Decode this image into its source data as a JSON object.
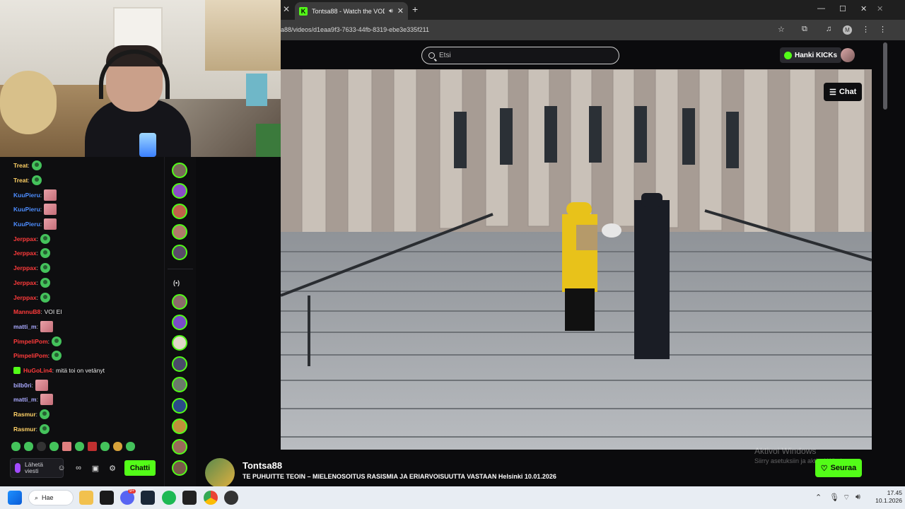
{
  "browser": {
    "tab_title": "Tontsa88 - Watch the VOD",
    "url": "a88/videos/d1eaa9f3-7633-44fb-8319-ebe3e335f211",
    "profile_initial": "M"
  },
  "kick": {
    "search_placeholder": "Etsi",
    "get_kicks_label": "Hanki KICKs",
    "chat_toggle_label": "Chat",
    "channel_name": "Tontsa88",
    "video_title": "TE PUHUITTE TEOIN – MIELENOSOITUS RASISMIA JA ERIARVOISUUTTA VASTAAN Helsinki 10.01.2026",
    "follow_label": "Seuraa"
  },
  "chat": {
    "messages": [
      {
        "user": "Treat",
        "color": "#ffd166",
        "text": "",
        "emote": "green"
      },
      {
        "user": "Treat",
        "color": "#ffd166",
        "text": "",
        "emote": "green"
      },
      {
        "user": "KuuPieru",
        "color": "#4d8dff",
        "text": "",
        "emote": "pink"
      },
      {
        "user": "KuuPieru",
        "color": "#4d8dff",
        "text": "",
        "emote": "pink"
      },
      {
        "user": "KuuPieru",
        "color": "#4d8dff",
        "text": "",
        "emote": "pink"
      },
      {
        "user": "Jerppax",
        "color": "#ff3b3b",
        "text": "",
        "emote": "green"
      },
      {
        "user": "Jerppax",
        "color": "#ff3b3b",
        "text": "",
        "emote": "green"
      },
      {
        "user": "Jerppax",
        "color": "#ff3b3b",
        "text": "",
        "emote": "green"
      },
      {
        "user": "Jerppax",
        "color": "#ff3b3b",
        "text": "",
        "emote": "green"
      },
      {
        "user": "Jerppax",
        "color": "#ff3b3b",
        "text": "",
        "emote": "green"
      },
      {
        "user": "MannuB8",
        "color": "#ff3b3b",
        "text": "VOI EI",
        "emote": ""
      },
      {
        "user": "matti_m",
        "color": "#a9a9ff",
        "text": "",
        "emote": "pink"
      },
      {
        "user": "PimpeliPom",
        "color": "#ff3b3b",
        "text": "",
        "emote": "green"
      },
      {
        "user": "PimpeliPom",
        "color": "#ff3b3b",
        "text": "",
        "emote": "green"
      },
      {
        "user": "HuGoLin4",
        "color": "#ff3b3b",
        "text": "mitä toi on vetänyt",
        "emote": "",
        "badge": true
      },
      {
        "user": "bilb0ri",
        "color": "#a9a9ff",
        "text": "",
        "emote": "pink"
      },
      {
        "user": "matti_m",
        "color": "#a9a9ff",
        "text": "",
        "emote": "pink"
      },
      {
        "user": "Rasmur",
        "color": "#ffd166",
        "text": "",
        "emote": "green"
      },
      {
        "user": "Rasmur",
        "color": "#ffd166",
        "text": "",
        "emote": "green"
      }
    ],
    "input_placeholder": "Lähetä viesti",
    "send_label": "Chatti"
  },
  "watermark": {
    "line1": "Aktivoi Windows",
    "line2": "Siirry asetuksiin ja aktivoi Windows."
  },
  "taskbar": {
    "search_label": "Hae",
    "discord_badge": "9+",
    "time": "17.45",
    "date": "10.1.2026"
  }
}
